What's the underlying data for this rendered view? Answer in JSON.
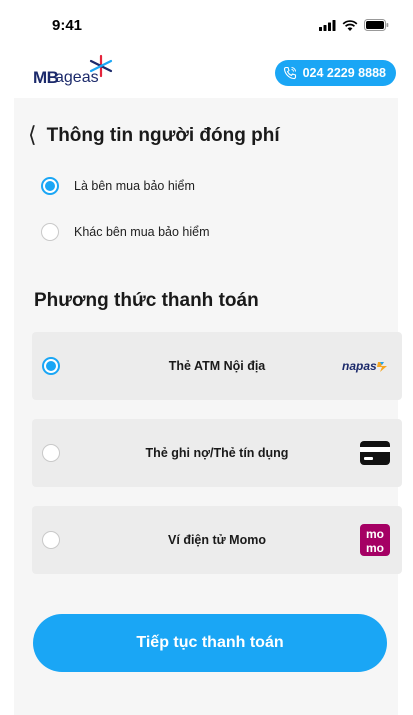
{
  "status_bar": {
    "time": "9:41"
  },
  "header": {
    "logo_mb": "MB",
    "logo_ageas": "ageas",
    "hotline": "024 2229 8888"
  },
  "payer": {
    "title": "Thông tin người đóng phí",
    "options": [
      {
        "label": "Là bên mua bảo hiểm",
        "checked": true
      },
      {
        "label": "Khác bên mua bảo hiểm",
        "checked": false
      }
    ]
  },
  "payment": {
    "title": "Phương thức thanh toán",
    "methods": [
      {
        "label": "Thẻ ATM Nội địa",
        "checked": true,
        "logo": "napas-logo",
        "logo_text": "napas"
      },
      {
        "label": "Thẻ ghi nợ/Thẻ tín dụng",
        "checked": false,
        "logo": "credit-card-icon"
      },
      {
        "label": "Ví điện tử Momo",
        "checked": false,
        "logo": "momo-logo",
        "logo_text_top": "mo",
        "logo_text_bottom": "mo"
      }
    ]
  },
  "cta": {
    "label": "Tiếp tục thanh toán"
  },
  "colors": {
    "accent": "#1aa6f5",
    "brand_dark": "#1c2a6b",
    "momo": "#a50064"
  }
}
